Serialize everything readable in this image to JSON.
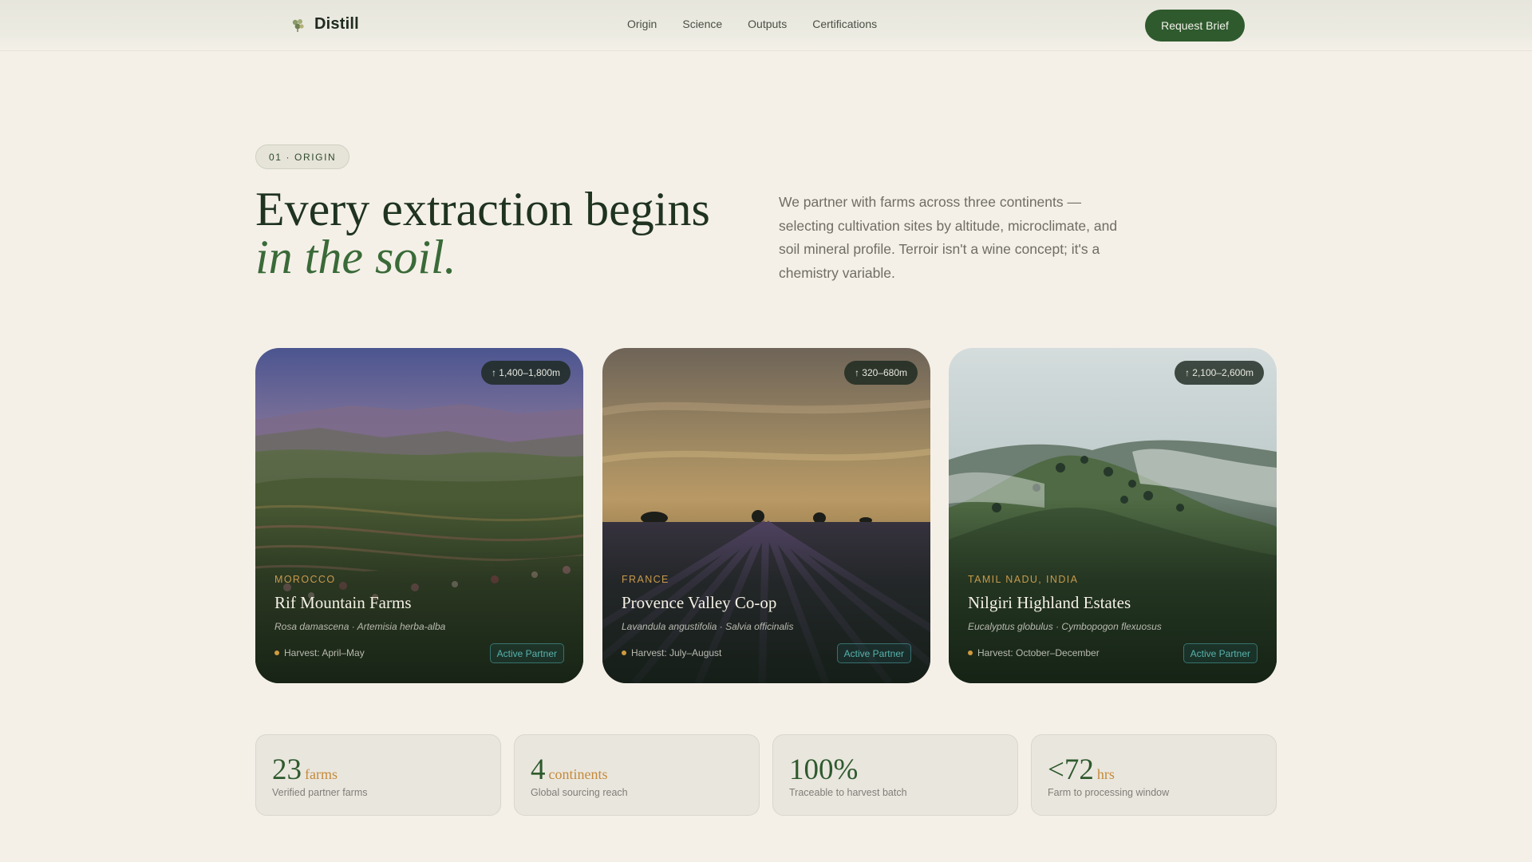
{
  "nav": {
    "brand": "Distill",
    "brand_icon": "leaf-cluster-icon",
    "links": [
      "Origin",
      "Science",
      "Outputs",
      "Certifications"
    ],
    "cta": "Request Brief"
  },
  "hero": {
    "badge": "01 · ORIGIN",
    "headline_line1": "Every extraction begins",
    "headline_line2": "in the soil.",
    "intro": "We partner with farms across three continents — selecting cultivation sites by altitude, microclimate, and soil mineral profile. Terroir isn't a wine concept; it's a chemistry variable."
  },
  "cards": [
    {
      "altitude": "↑ 1,400–1,800m",
      "region": "MOROCCO",
      "name": "Rif Mountain Farms",
      "species": "Rosa damascena · Artemisia herba-alba",
      "harvest": "Harvest: April–May",
      "status": "Active Partner"
    },
    {
      "altitude": "↑ 320–680m",
      "region": "FRANCE",
      "name": "Provence Valley Co-op",
      "species": "Lavandula angustifolia · Salvia officinalis",
      "harvest": "Harvest: July–August",
      "status": "Active Partner"
    },
    {
      "altitude": "↑ 2,100–2,600m",
      "region": "TAMIL NADU, INDIA",
      "name": "Nilgiri Highland Estates",
      "species": "Eucalyptus globulus · Cymbopogon flexuosus",
      "harvest": "Harvest: October–December",
      "status": "Active Partner"
    }
  ],
  "stats": [
    {
      "value": "23",
      "unit": "farms",
      "label": "Verified partner farms"
    },
    {
      "value": "4",
      "unit": "continents",
      "label": "Global sourcing reach"
    },
    {
      "value": "100%",
      "unit": "",
      "label": "Traceable to harvest batch"
    },
    {
      "value": "<72",
      "unit": "hrs",
      "label": "Farm to processing window"
    }
  ],
  "colors": {
    "background": "#f4f0e8",
    "brand_green": "#2f5a2e",
    "accent_amber": "#c48a3a",
    "partner_teal": "#57b3ad"
  }
}
